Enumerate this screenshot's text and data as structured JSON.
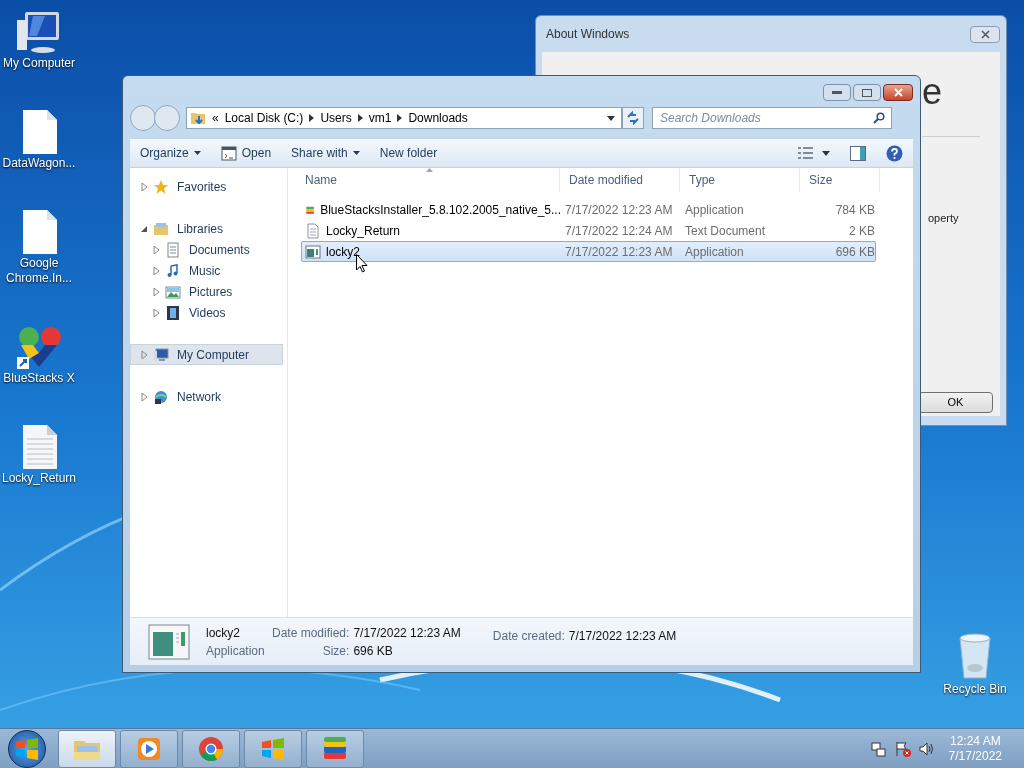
{
  "desktop_icons": [
    {
      "label": "My Computer",
      "kind": "computer"
    },
    {
      "label": "DataWagon...",
      "kind": "blank"
    },
    {
      "label": "Google Chrome.In...",
      "kind": "blank"
    },
    {
      "label": "BlueStacks X",
      "kind": "bluestacks"
    },
    {
      "label": "Locky_Return",
      "kind": "text"
    }
  ],
  "recycle_bin": {
    "label": "Recycle Bin"
  },
  "about_window": {
    "title": "About Windows",
    "heading_fragment": "e",
    "text_fragment": "operty",
    "ok_button": "OK"
  },
  "explorer": {
    "breadcrumb_prefix": "«",
    "path": [
      "Local Disk (C:)",
      "Users",
      "vm1",
      "Downloads"
    ],
    "search_placeholder": "Search Downloads",
    "toolbar": [
      {
        "label": "Organize",
        "kind": "menu"
      },
      {
        "label": "Open",
        "kind": "icon"
      },
      {
        "label": "Share with",
        "kind": "menu"
      },
      {
        "label": "New folder",
        "kind": "plain"
      }
    ],
    "nav": [
      {
        "label": "Favorites",
        "kind": "star",
        "expanded": false,
        "selected": false
      },
      {
        "label": "Libraries",
        "kind": "library",
        "expanded": true,
        "selected": false,
        "children": [
          {
            "label": "Documents",
            "kind": "documents",
            "expanded": false,
            "selected": false
          },
          {
            "label": "Music",
            "kind": "music",
            "expanded": false,
            "selected": false
          },
          {
            "label": "Pictures",
            "kind": "pictures",
            "expanded": false,
            "selected": false
          },
          {
            "label": "Videos",
            "kind": "videos",
            "expanded": false,
            "selected": false
          }
        ]
      },
      {
        "label": "My Computer",
        "kind": "computer",
        "expanded": false,
        "selected": true
      },
      {
        "label": "Network",
        "kind": "network",
        "expanded": false,
        "selected": false
      }
    ],
    "columns": [
      "Name",
      "Date modified",
      "Type",
      "Size"
    ],
    "rows": [
      {
        "name": "BlueStacksInstaller_5.8.102.2005_native_5...",
        "date": "7/17/2022 12:23 AM",
        "type": "Application",
        "size": "784 KB",
        "kind": "bluestacks",
        "selected": false
      },
      {
        "name": "Locky_Return",
        "date": "7/17/2022 12:24 AM",
        "type": "Text Document",
        "size": "2 KB",
        "kind": "text",
        "selected": false
      },
      {
        "name": "locky2",
        "date": "7/17/2022 12:23 AM",
        "type": "Application",
        "size": "696 KB",
        "kind": "app",
        "selected": true
      }
    ],
    "details": {
      "name": "locky2",
      "type": "Application",
      "modified_label": "Date modified:",
      "modified": "7/17/2022 12:23 AM",
      "size_label": "Size:",
      "size": "696 KB",
      "created_label": "Date created:",
      "created": "7/17/2022 12:23 AM"
    }
  },
  "taskbar": {
    "buttons": [
      {
        "kind": "explorer",
        "selected": true
      },
      {
        "kind": "media",
        "selected": false
      },
      {
        "kind": "chrome",
        "selected": false
      },
      {
        "kind": "windows",
        "selected": false
      },
      {
        "kind": "bluestacks",
        "selected": false
      }
    ],
    "clock": {
      "time": "12:24 AM",
      "date": "7/17/2022"
    }
  }
}
